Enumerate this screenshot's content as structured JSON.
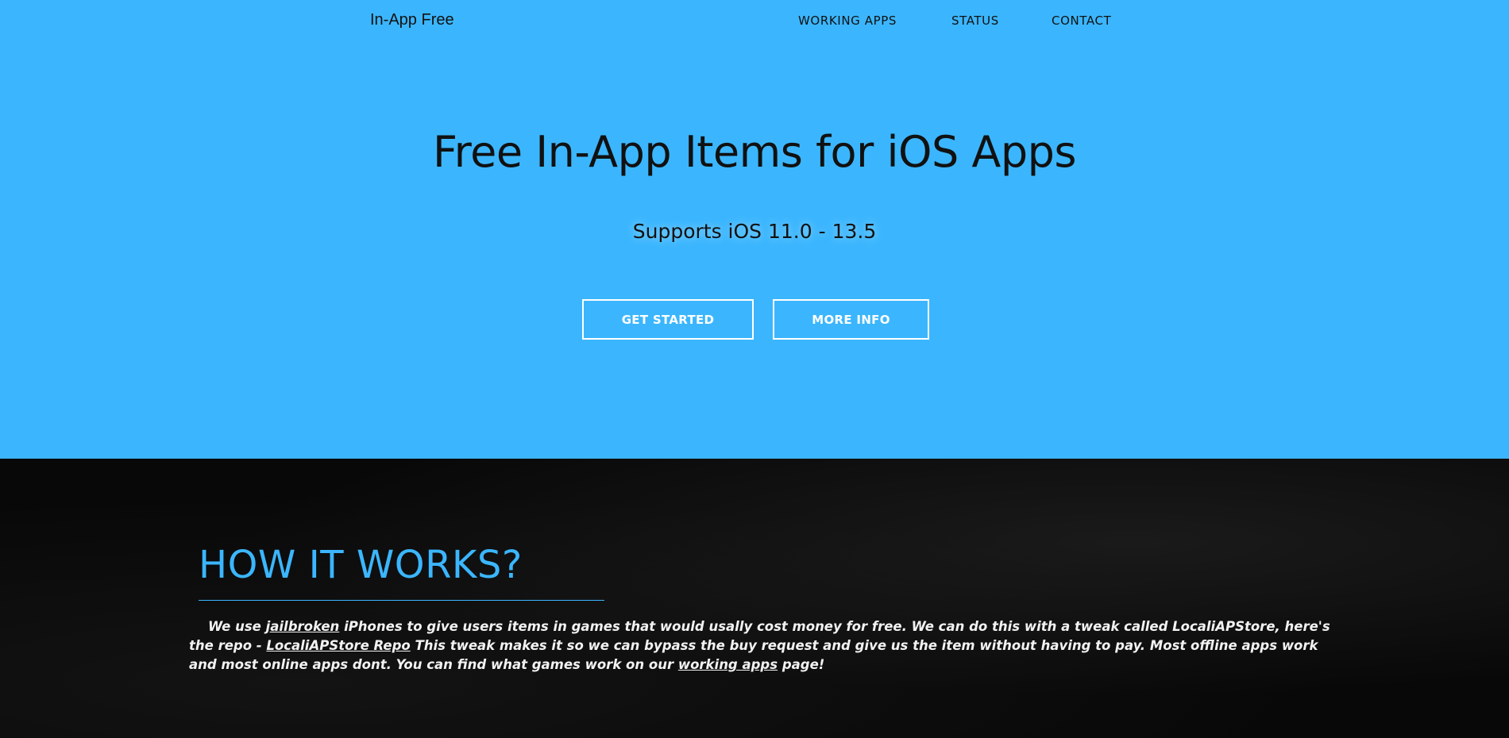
{
  "brand": "In-App Free",
  "nav": {
    "items": [
      {
        "label": "WORKING APPS"
      },
      {
        "label": "STATUS"
      },
      {
        "label": "CONTACT"
      }
    ]
  },
  "hero": {
    "title": "Free In-App Items for iOS Apps",
    "subtitle": "Supports iOS 11.0 - 13.5",
    "primary_button": "GET STARTED",
    "secondary_button": "MORE INFO"
  },
  "how": {
    "title": "HOW IT WORKS?",
    "p1": "We use",
    "link_jailbroken": "jailbroken",
    "p2": "iPhones to give users items in games that would usally cost money for free. We can do this with a tweak called LocaliAPStore, here's the repo -",
    "link_repo": "LocaliAPStore Repo",
    "p3": "This tweak makes it so we can bypass the buy request and give us the item without having to pay. Most offline apps work and most online apps dont. You can find what games work on our",
    "link_working_apps": "working apps",
    "p4": "page!"
  },
  "colors": {
    "hero_background": "#3bb6fe",
    "accent": "#3bb6fe",
    "dark_background": "#080808"
  }
}
